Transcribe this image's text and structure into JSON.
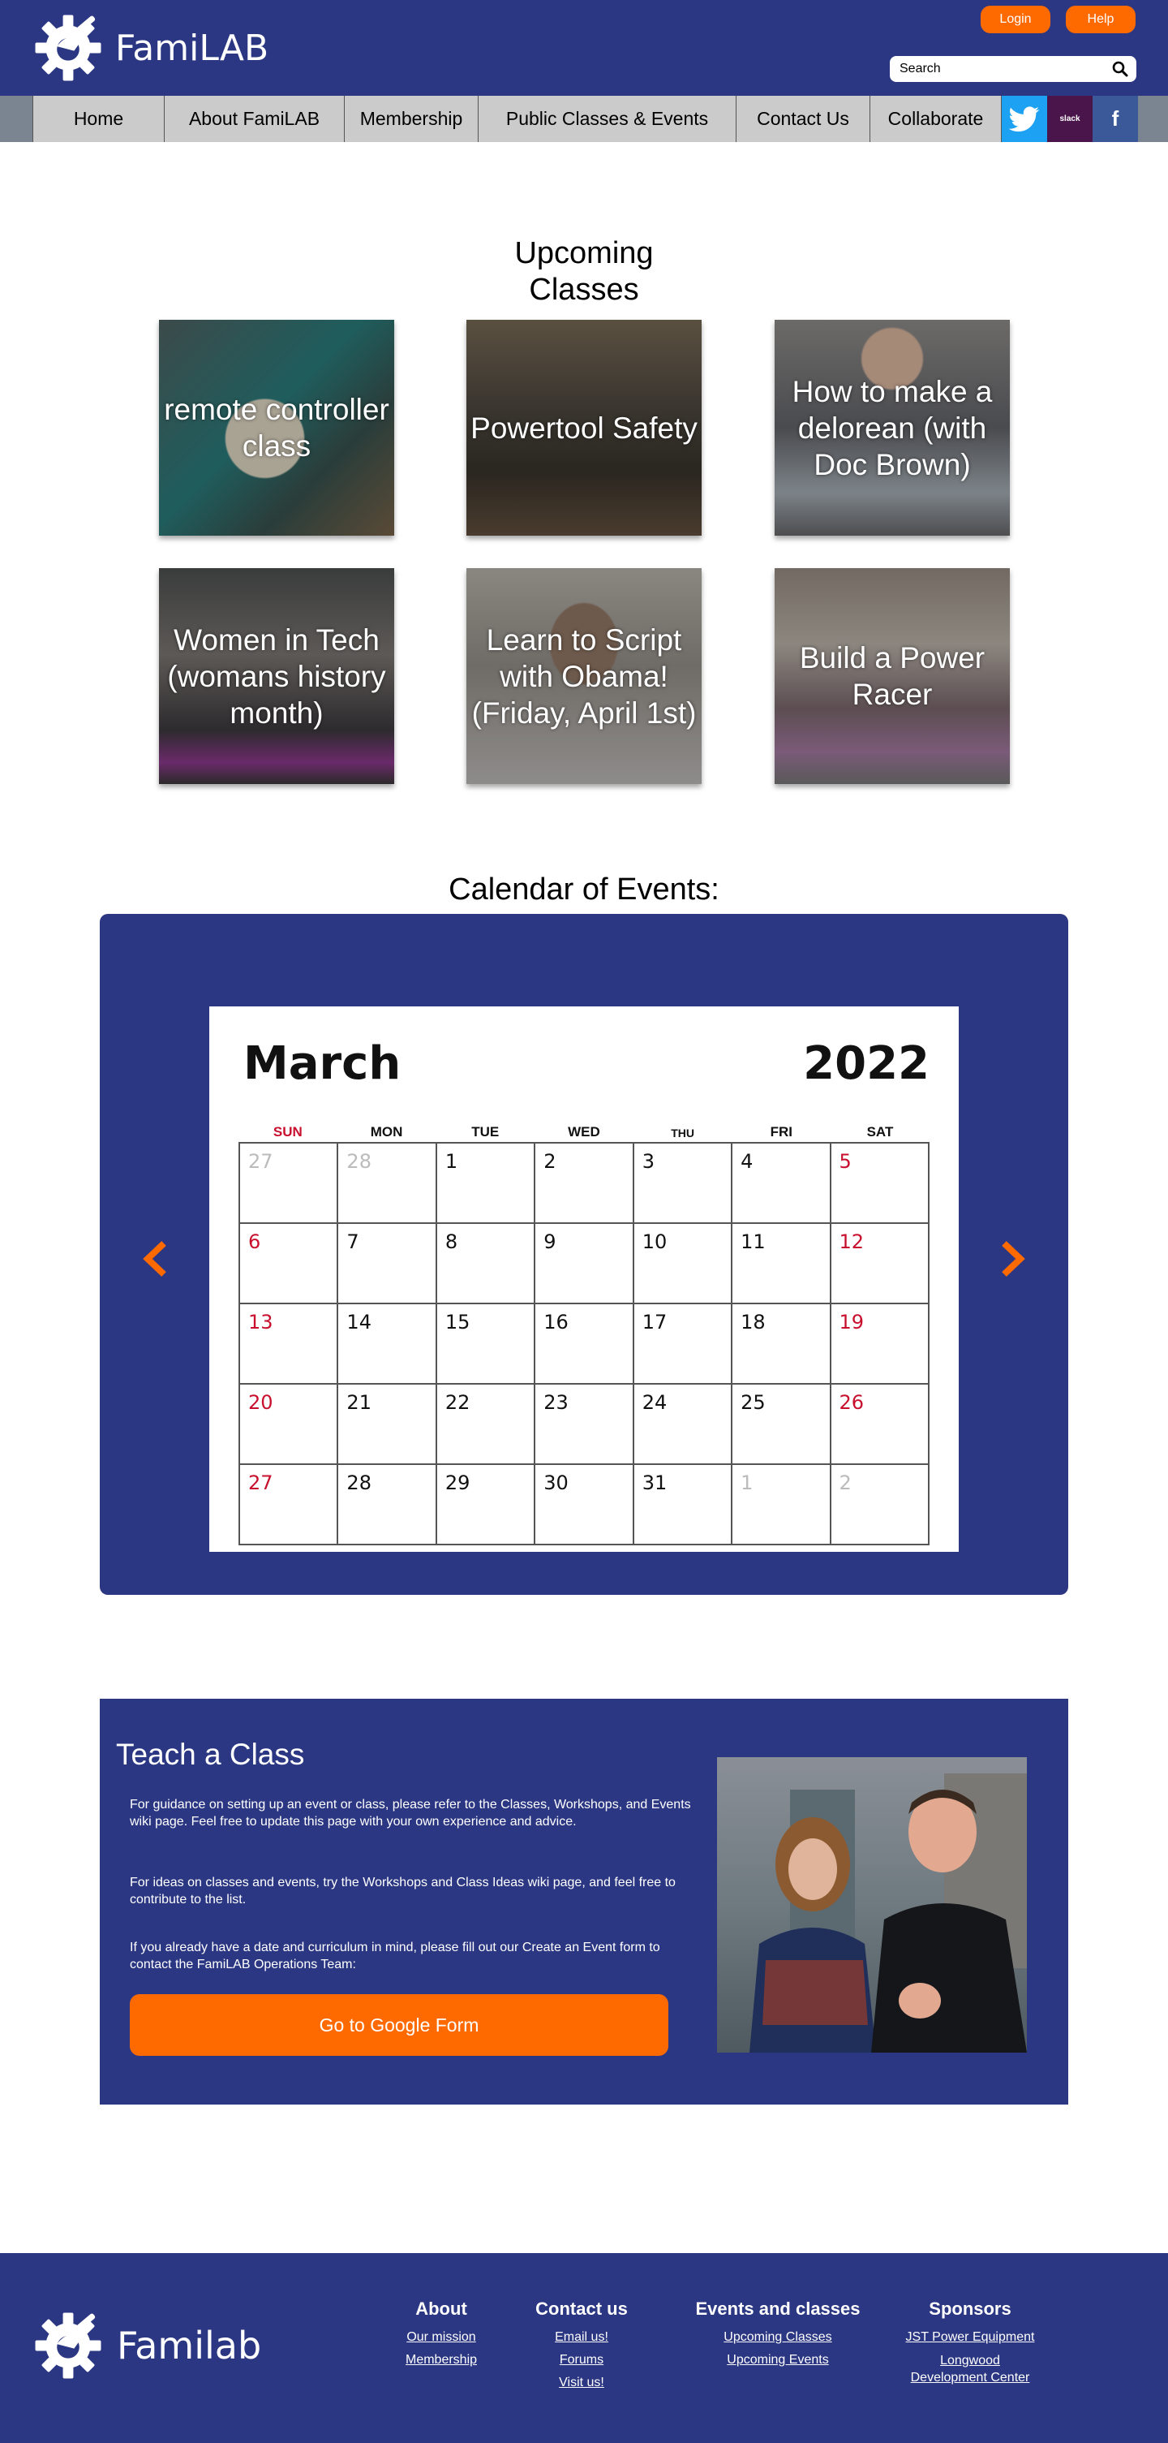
{
  "header": {
    "brand": "FamiLAB",
    "login_label": "Login",
    "help_label": "Help",
    "search_placeholder": "Search"
  },
  "nav": {
    "items": [
      "Home",
      "About FamiLAB",
      "Membership",
      "Public Classes & Events",
      "Contact Us",
      "Collaborate"
    ],
    "social": {
      "slack": "slack",
      "facebook": "f"
    }
  },
  "classes": {
    "title_line1": "Upcoming",
    "title_line2": "Classes",
    "cards": [
      "remote controller class",
      "Powertool Safety",
      "How to make a delorean (with Doc Brown)",
      "Women in Tech (womans history month)",
      "Learn to Script with Obama! (Friday, April 1st)",
      "Build a Power Racer"
    ]
  },
  "calendar": {
    "title": "Calendar of Events:",
    "month": "March",
    "year": "2022",
    "days_of_week": [
      "SUN",
      "MON",
      "TUE",
      "WED",
      "THU",
      "FRI",
      "SAT"
    ],
    "weeks": [
      [
        "27",
        "28",
        "1",
        "2",
        "3",
        "4",
        "5"
      ],
      [
        "6",
        "7",
        "8",
        "9",
        "10",
        "11",
        "12"
      ],
      [
        "13",
        "14",
        "15",
        "16",
        "17",
        "18",
        "19"
      ],
      [
        "20",
        "21",
        "22",
        "23",
        "24",
        "25",
        "26"
      ],
      [
        "27",
        "28",
        "29",
        "30",
        "31",
        "1",
        "2"
      ]
    ]
  },
  "teach": {
    "title": "Teach a Class",
    "p1": "For guidance on setting up an event or class, please refer to the Classes, Workshops, and Events wiki page. Feel free to update this page with your own experience and advice.",
    "p2": "For ideas on classes and events, try the Workshops and Class Ideas wiki page, and feel free to contribute to the list.",
    "p3": "If you already have a date and curriculum in mind, please fill out our Create an Event form to contact the FamiLAB Operations Team:",
    "button_label": "Go to Google Form"
  },
  "footer": {
    "brand": "Familab",
    "about": {
      "heading": "About",
      "links": [
        "Our mission",
        "Membership"
      ]
    },
    "contact": {
      "heading": "Contact us",
      "links": [
        "Email us!",
        "Forums",
        "Visit us!"
      ]
    },
    "events": {
      "heading": "Events and classes",
      "links": [
        "Upcoming Classes",
        "Upcoming Events"
      ]
    },
    "sponsors": {
      "heading": "Sponsors",
      "links": [
        "JST Power Equipment",
        "Longwood Development Center"
      ]
    }
  },
  "colors": {
    "brand_navy": "#2b3782",
    "accent_orange": "#ff6a00",
    "nav_gray": "#cbcbcb",
    "weekend_red": "#c8102e"
  }
}
